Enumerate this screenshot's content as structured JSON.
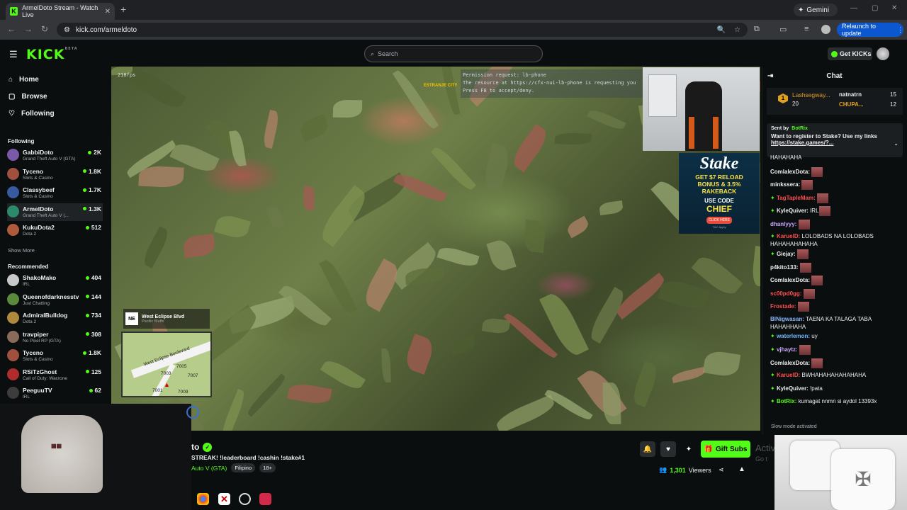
{
  "browser": {
    "tab_title": "ArmelDoto Stream - Watch Live",
    "tab_close": "✕",
    "new_tab": "+",
    "gemini": "Gemini",
    "url": "kick.com/armeldoto",
    "relaunch": "Relaunch to update"
  },
  "header": {
    "logo": "KICK",
    "logo_tag": "BETA",
    "search_placeholder": "Search",
    "get_kicks": "Get KICKs"
  },
  "nav": [
    {
      "label": "Home",
      "icon": "⌂"
    },
    {
      "label": "Browse",
      "icon": "▢"
    },
    {
      "label": "Following",
      "icon": "♡"
    }
  ],
  "following_header": "Following",
  "following": [
    {
      "name": "GabbiDoto",
      "game": "Grand Theft Auto V (GTA)",
      "viewers": "2K",
      "color": "#7a5aa8"
    },
    {
      "name": "Tyceno",
      "game": "Slots & Casino",
      "viewers": "1.8K",
      "color": "#a0503c"
    },
    {
      "name": "Classybeef",
      "game": "Slots & Casino",
      "viewers": "1.7K",
      "color": "#3a5aa0"
    },
    {
      "name": "ArmelDoto",
      "game": "Grand Theft Auto V (...",
      "viewers": "1.3K",
      "color": "#2c8a6a"
    },
    {
      "name": "KukuDota2",
      "game": "Dota 2",
      "viewers": "512",
      "color": "#b05a3c"
    }
  ],
  "show_more": "Show More",
  "recommended_header": "Recommended",
  "recommended": [
    {
      "name": "ShakoMako",
      "game": "IRL",
      "viewers": "404",
      "color": "#c8c8c8"
    },
    {
      "name": "Queenofdarknesstv",
      "game": "Just Chatting",
      "viewers": "144",
      "color": "#5a8a3c"
    },
    {
      "name": "AdmiralBulldog",
      "game": "Dota 2",
      "viewers": "734",
      "color": "#b08a3c"
    },
    {
      "name": "travpiper",
      "game": "No Pixel RP (GTA)",
      "viewers": "308",
      "color": "#8a6a5a"
    },
    {
      "name": "Tyceno",
      "game": "Slots & Casino",
      "viewers": "1.8K",
      "color": "#a0503c"
    },
    {
      "name": "RSiTzGhost",
      "game": "Call of Duty: Warzone",
      "viewers": "125",
      "color": "#b02c2c"
    },
    {
      "name": "PeeguuTV",
      "game": "IRL",
      "viewers": "62",
      "color": "#3c3c3c"
    }
  ],
  "video": {
    "fps": "218fps",
    "console": [
      "Permission request: lb-phone",
      "The resource at https://cfx-nui-lb-phone is requesting you",
      "Press F8 to accept/deny."
    ],
    "city": "ESTRANJE CITY",
    "street_dir": "NE",
    "street": "West Eclipse Blvd",
    "street_sub": "Pacific Bluffs",
    "map_road": "West Eclipse Boulevard",
    "map_nums": [
      "7005",
      "7003",
      "7007",
      "7009",
      "7001"
    ]
  },
  "stake_ad": {
    "brand": "Stake",
    "line1": "GET $7 RELOAD",
    "line2": "BONUS & 3.5%",
    "line3": "RAKEBACK",
    "use_code": "USE CODE",
    "code": "CHIEF",
    "button": "CLICK HERE",
    "fine": "T&C Apply"
  },
  "stream": {
    "name": "to",
    "title": "STREAK! !leaderboard !cashin !stake#1",
    "category": "Auto V (GTA)",
    "tags": [
      "Filipino",
      "18+"
    ],
    "gift_subs": "Gift Subs",
    "viewers": "1,301",
    "viewers_label": "Viewers",
    "activate": "Activ",
    "goto": "Go t"
  },
  "chat": {
    "title": "Chat",
    "leaderboard": [
      {
        "rank": "1",
        "name": "Lashsegway...",
        "value": "20"
      },
      {
        "name": "natnatrn",
        "value": "15"
      },
      {
        "name": "CHUPA...",
        "value": "12"
      }
    ],
    "pinned": {
      "sent_by": "Sent by",
      "bot": "BotRix",
      "text": "Want to register to Stake? Use my links",
      "link": "https://stake.games/?..."
    },
    "messages": [
      {
        "user": "",
        "text": "HAHAHAHA",
        "color": "#efeff1",
        "emote": false,
        "badge": false
      },
      {
        "user": "ComlalexDota:",
        "text": "",
        "color": "#efeff1",
        "emote": true,
        "badge": false
      },
      {
        "user": "minkssera:",
        "text": "",
        "color": "#efeff1",
        "emote": true,
        "badge": false
      },
      {
        "user": "TagTapleMam:",
        "text": "",
        "color": "#ff4d4d",
        "emote": true,
        "badge": true
      },
      {
        "user": "KyleQuiver:",
        "text": "IRL",
        "color": "#efeff1",
        "emote": true,
        "badge": true
      },
      {
        "user": "dhanlyyy:",
        "text": "",
        "color": "#c9a6ff",
        "emote": true,
        "badge": false
      },
      {
        "user": "KaruelD:",
        "text": "LOLOBADS NA LOLOBADS HAHAHAHAHAHA",
        "color": "#ff4d4d",
        "emote": false,
        "badge": true
      },
      {
        "user": "Giejay:",
        "text": "",
        "color": "#efeff1",
        "emote": true,
        "badge": true
      },
      {
        "user": "p4kito133:",
        "text": "",
        "color": "#efeff1",
        "emote": true,
        "badge": false
      },
      {
        "user": "ComlalexDota:",
        "text": "",
        "color": "#efeff1",
        "emote": true,
        "badge": false
      },
      {
        "user": "sc00pd0gg:",
        "text": "",
        "color": "#ff4d4d",
        "emote": true,
        "badge": false
      },
      {
        "user": "Frostade:",
        "text": "",
        "color": "#ff4d4d",
        "emote": true,
        "badge": false
      },
      {
        "user": "BINigwasan:",
        "text": "TAENA KA TALAGA TABA HAHAHHAHA",
        "color": "#8ab4ff",
        "emote": false,
        "badge": false
      },
      {
        "user": "waterlemon:",
        "text": "uy",
        "color": "#6fb7ff",
        "emote": false,
        "badge": true
      },
      {
        "user": "vjhaytz:",
        "text": "",
        "color": "#c9a6ff",
        "emote": true,
        "badge": true
      },
      {
        "user": "ComlalexDota:",
        "text": "",
        "color": "#efeff1",
        "emote": true,
        "badge": false
      },
      {
        "user": "KaruelD:",
        "text": "BWHAHAHAHAHAHAHA",
        "color": "#ff4d4d",
        "emote": false,
        "badge": true
      },
      {
        "user": "KyleQuiver:",
        "text": "!pata",
        "color": "#efeff1",
        "emote": false,
        "badge": true
      },
      {
        "user": "BotRix:",
        "text": "kumagat nnmn si aydol 13393x",
        "color": "#53fc18",
        "emote": false,
        "badge": true
      }
    ],
    "slow_mode": "Slow mode activated"
  }
}
